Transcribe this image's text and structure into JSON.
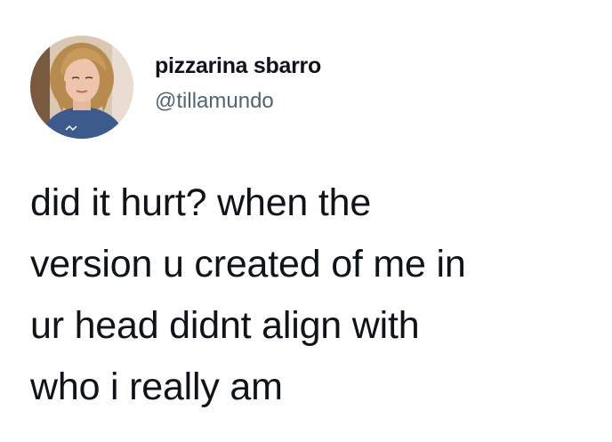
{
  "author": {
    "display_name": "pizzarina sbarro",
    "handle": "@tillamundo",
    "avatar_icon": "profile-photo"
  },
  "tweet": {
    "lines": [
      "did it hurt? when the",
      "version u created of me in",
      "ur head didnt align with",
      "who i really am"
    ]
  },
  "colors": {
    "text_primary": "#0f1419",
    "text_secondary": "#536471",
    "background": "#ffffff"
  }
}
